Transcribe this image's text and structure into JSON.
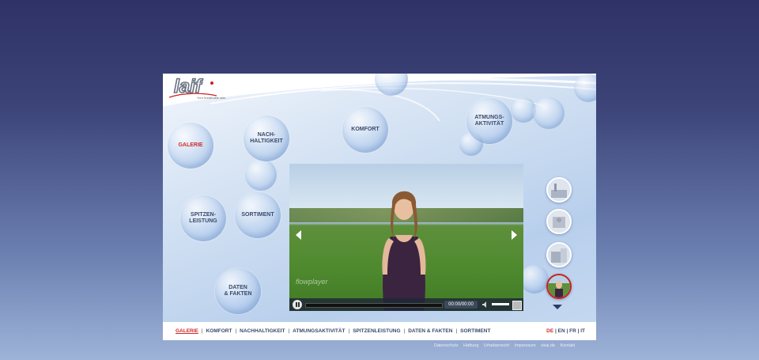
{
  "logo": {
    "brand": "laif",
    "tagline": "Your breathable skin"
  },
  "menu": {
    "galerie": "GALERIE",
    "nachhaltigkeit": [
      "NACH-",
      "HALTIGKEIT"
    ],
    "komfort": "KOMFORT",
    "atmungsaktivitaet": [
      "ATMUNGS-",
      "AKTIVITÄT"
    ],
    "spitzenleistung": [
      "SPITZEN-",
      "LEISTUNG"
    ],
    "sortiment": "SORTIMENT",
    "daten": [
      "DATEN",
      "& FAKTEN"
    ]
  },
  "player": {
    "watermark": "flowplayer",
    "time": "00:00/00:00"
  },
  "nav": {
    "items": [
      "GALERIE",
      "KOMFORT",
      "NACHHALTIGKEIT",
      "ATMUNGSAKTIVITÄT",
      "SPITZENLEISTUNG",
      "DATEN & FAKTEN",
      "SORTIMENT"
    ],
    "separator": "|"
  },
  "lang": {
    "de": "DE",
    "en": "EN",
    "fr": "FR",
    "it": "IT",
    "separator": "|"
  },
  "footer": [
    "Datenschutz",
    "Haftung",
    "Urheberrecht",
    "Impressum",
    "ekai.de",
    "Kontakt"
  ],
  "colors": {
    "accent": "#d12b2b",
    "text": "#3a4a6a"
  }
}
